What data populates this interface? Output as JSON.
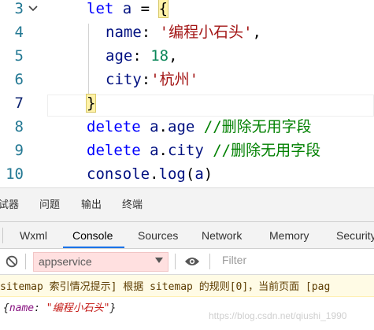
{
  "editor": {
    "lines": [
      {
        "num": "3",
        "kw": "let",
        "name": "a",
        "op": " = ",
        "brace": "{"
      },
      {
        "num": "4",
        "prop": "name",
        "colon": ": ",
        "value": "'编程小石头'",
        "tail": ","
      },
      {
        "num": "5",
        "prop": "age",
        "colon": ": ",
        "value": "18",
        "tail": ","
      },
      {
        "num": "6",
        "prop": "city",
        "colon": ":",
        "value": "'杭州'"
      },
      {
        "num": "7",
        "brace": "}"
      },
      {
        "num": "8",
        "kw": "delete",
        "obj": "a",
        "dot": ".",
        "prop": "age",
        "comment": "//删除无用字段"
      },
      {
        "num": "9",
        "kw": "delete",
        "obj": "a",
        "dot": ".",
        "prop": "city",
        "comment": "//删除无用字段"
      },
      {
        "num": "10",
        "obj": "console",
        "dot": ".",
        "prop": "log",
        "open": "(",
        "arg": "a",
        "close": ")"
      }
    ]
  },
  "panel_tabs": [
    "试器",
    "问题",
    "输出",
    "终端"
  ],
  "devtools_tabs": [
    "Wxml",
    "Console",
    "Sources",
    "Network",
    "Memory",
    "Security"
  ],
  "toolbar": {
    "context": "appservice",
    "filter_placeholder": "Filter"
  },
  "console": {
    "warning": "sitemap 索引情况提示] 根据 sitemap 的规则[0]，当前页面 [pag",
    "log_open": "{",
    "log_key": "name",
    "log_colon": ": ",
    "log_value": "\"编程小石头\"",
    "log_close": "}"
  },
  "watermark": "https://blog.csdn.net/qiushi_1990"
}
